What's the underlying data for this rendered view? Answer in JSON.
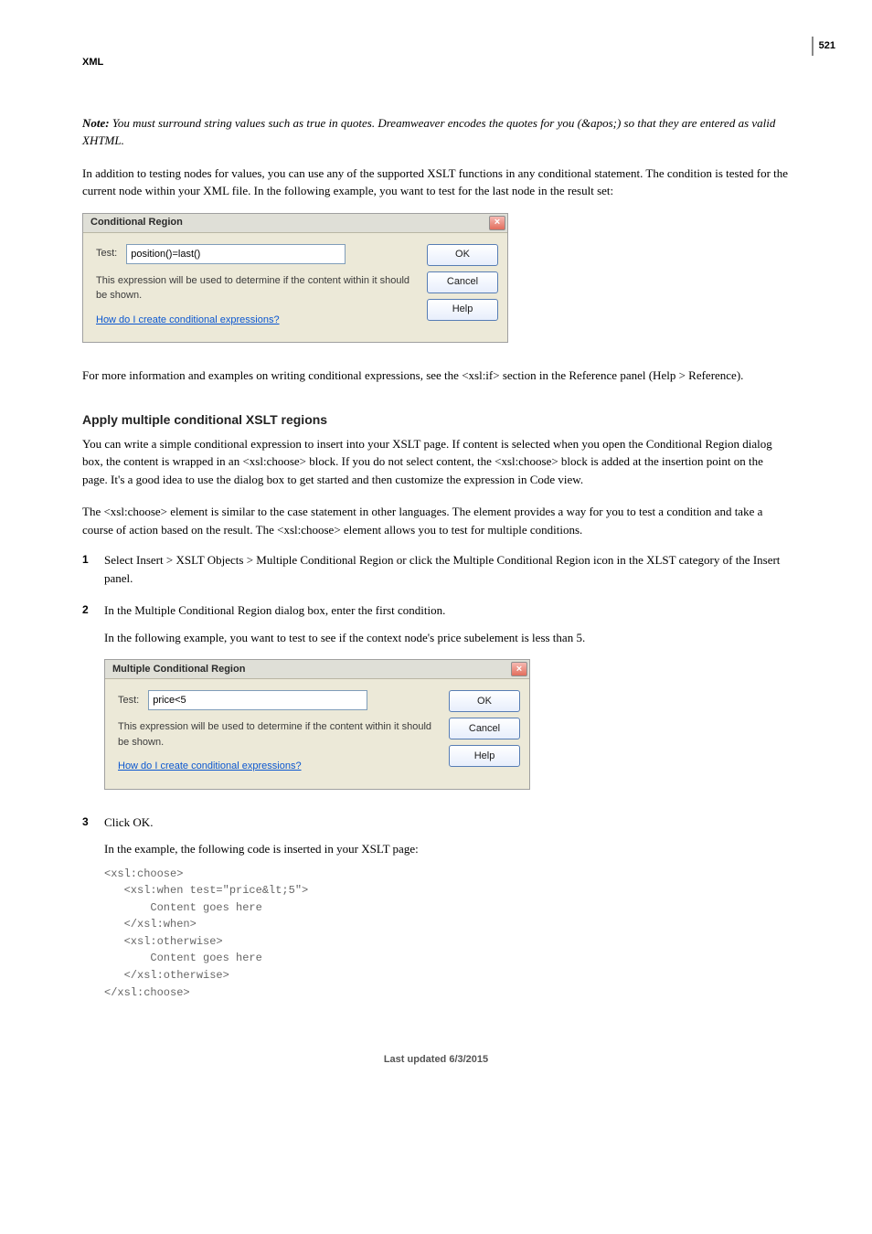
{
  "header": {
    "section": "XML",
    "page_number": "521"
  },
  "note": {
    "lead": "Note:",
    "body": " You must surround string values such as true in quotes. Dreamweaver encodes the quotes for you (&apos;) so that they are entered as valid XHTML."
  },
  "p1": "In addition to testing nodes for values, you can use any of the supported XSLT functions in any conditional statement. The condition is tested for the current node within your XML file. In the following example, you want to test for the last node in the result set:",
  "dialog1": {
    "title": "Conditional Region",
    "test_label": "Test:",
    "test_value": "position()=last()",
    "hint": "This expression will be used to determine if the content within it should be shown.",
    "help_link": "How do I create conditional expressions?",
    "buttons": {
      "ok": "OK",
      "cancel": "Cancel",
      "help": "Help"
    },
    "close": "×"
  },
  "p2": "For more information and examples on writing conditional expressions, see the <xsl:if> section in the Reference panel (Help > Reference).",
  "section_heading": "Apply multiple conditional XSLT regions",
  "p3": "You can write a simple conditional expression to insert into your XSLT page. If content is selected when you open the Conditional Region dialog box, the content is wrapped in an <xsl:choose> block. If you do not select content, the <xsl:choose> block is added at the insertion point on the page. It's a good idea to use the dialog box to get started and then customize the expression in Code view.",
  "p4": "The <xsl:choose> element is similar to the case statement in other languages. The element provides a way for you to test a condition and take a course of action based on the result. The <xsl:choose> element allows you to test for multiple conditions.",
  "steps": [
    {
      "n": "1",
      "text": "Select Insert > XSLT Objects > Multiple Conditional Region or click the Multiple Conditional Region icon in the XLST category of the Insert panel."
    },
    {
      "n": "2",
      "text": "In the Multiple Conditional Region dialog box, enter the first condition.",
      "after": "In the following example, you want to test to see if the context node's price subelement is less than 5."
    },
    {
      "n": "3",
      "text": "Click OK.",
      "after2": "In the example, the following code is inserted in your XSLT page:"
    }
  ],
  "dialog2": {
    "title": "Multiple Conditional Region",
    "test_label": "Test:",
    "test_value": "price<5",
    "hint": "This expression will be used to determine if the content within it should be shown.",
    "help_link": "How do I create conditional expressions?",
    "buttons": {
      "ok": "OK",
      "cancel": "Cancel",
      "help": "Help"
    },
    "close": "×"
  },
  "code_block": "<xsl:choose>\n   <xsl:when test=\"price&lt;5\">\n       Content goes here\n   </xsl:when>\n   <xsl:otherwise>\n       Content goes here\n   </xsl:otherwise>\n</xsl:choose>",
  "footer": "Last updated 6/3/2015"
}
